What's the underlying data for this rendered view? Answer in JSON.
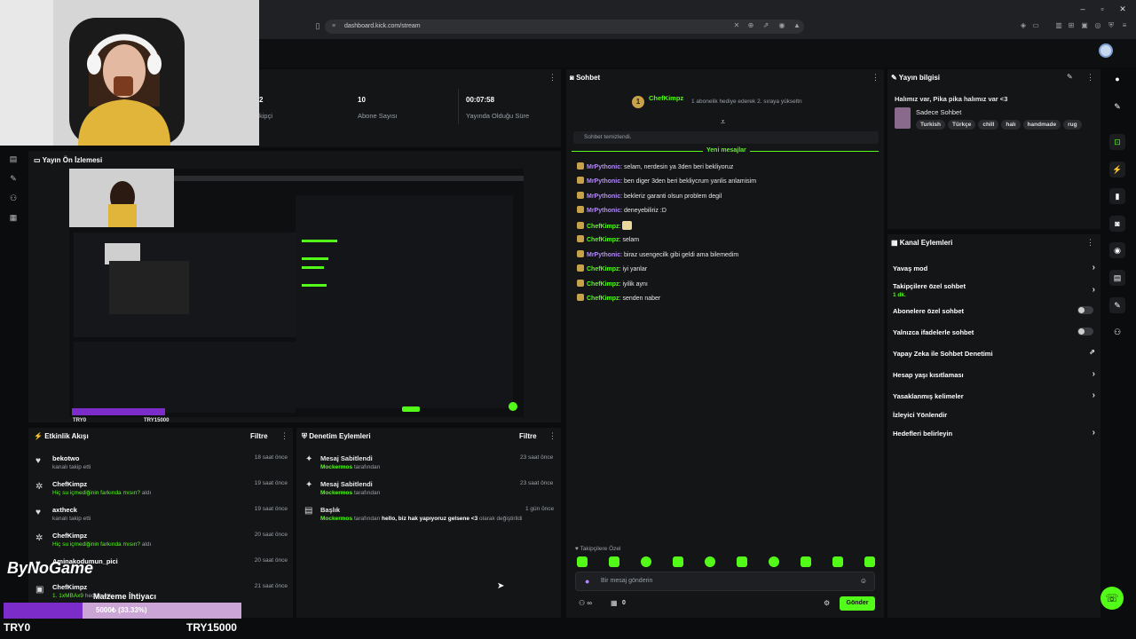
{
  "browser": {
    "url": "dashboard.kick.com/stream"
  },
  "stats": [
    {
      "value": "2",
      "label": "kipçi"
    },
    {
      "value": "10",
      "label": "Abone Sayısı"
    },
    {
      "value": "00:07:58",
      "label": "Yayında Olduğu Süre"
    }
  ],
  "preview": {
    "title": "Yayın Ön İzlemesi",
    "bar_left": "TRY0",
    "bar_right": "TRY15000"
  },
  "activity": {
    "title": "Etkinlik Akışı",
    "filter": "Filtre",
    "items": [
      {
        "user": "bekotwo",
        "sub": "kanalı takip etti",
        "time": "18 saat önce",
        "icon": "heart-icon"
      },
      {
        "user": "ChefKimpz",
        "sub_green": "Hiç su içmediğinin farkında mısın?",
        "sub": "aldı",
        "time": "19 saat önce",
        "icon": "reward-icon"
      },
      {
        "user": "axtheck",
        "sub": "kanalı takip etti",
        "time": "19 saat önce",
        "icon": "heart-icon"
      },
      {
        "user": "ChefKimpz",
        "sub_green": "Hiç su içmediğinin farkında mısın?",
        "sub": "aldı",
        "time": "20 saat önce",
        "icon": "reward-icon"
      },
      {
        "user": "Aminakodumun_pici",
        "sub": "",
        "time": "20 saat önce",
        "icon": "heart-icon"
      },
      {
        "user": "ChefKimpz",
        "sub_green": "1. 1xMBAx9",
        "sub": "hediye etti.",
        "time": "21 saat önce",
        "icon": "gift-icon"
      }
    ]
  },
  "moderation": {
    "title": "Denetim Eylemleri",
    "filter": "Filtre",
    "items": [
      {
        "title": "Mesaj Sabitlendi",
        "by": "Mockermos",
        "by_suffix": "tarafından",
        "time": "23 saat önce"
      },
      {
        "title": "Mesaj Sabitlendi",
        "by": "Mockermos",
        "by_suffix": "tarafından",
        "time": "23 saat önce"
      },
      {
        "title": "Başlık",
        "by": "Mockermos",
        "by_suffix": "tarafından",
        "text_bold": "hello, biz hak yapıyoruz gelsene <3",
        "text_end": "olarak değiştirildi",
        "time": "1 gün önce"
      }
    ]
  },
  "chat": {
    "title": "Sohbet",
    "pinned_user": "ChefKimpz",
    "pinned_text": "1 abonelik hediye ederek 2. sıraya yükseltn",
    "cleared": "Sohbet temizlendi.",
    "new_messages": "Yeni mesajlar",
    "messages": [
      {
        "user": "MrPythonic",
        "text": "selam, nerdesin ya 3den beri bekliyoruz"
      },
      {
        "user": "MrPythonic",
        "text": "ben diger 3den beri bekliycrum yanlis anlamisim"
      },
      {
        "user": "MrPythonic",
        "text": "bekleriz garanti olsun problem degil"
      },
      {
        "user": "MrPythonic",
        "text": "deneyebiliriz :D"
      },
      {
        "user": "ChefKimpz",
        "text": ""
      },
      {
        "user": "ChefKimpz",
        "text": "selam"
      },
      {
        "user": "MrPythonic",
        "text": "biraz usengecilk gibi geldi ama bilemedim"
      },
      {
        "user": "ChefKimpz",
        "text": "iyi yanlar"
      },
      {
        "user": "ChefKimpz",
        "text": "iyilik aynı"
      },
      {
        "user": "ChefKimpz",
        "text": "senden naber"
      }
    ],
    "followers_only": "Takipçilere Özel",
    "input_placeholder": "Bir mesaj gönderin",
    "viewers": "0",
    "send": "Gönder"
  },
  "stream_info": {
    "title": "Yayın bilgisi",
    "stream_title": "Halımız var, Pika pika halımız var <3",
    "category": "Sadece Sohbet",
    "tags": [
      "Turkish",
      "Türkçe",
      "chill",
      "halı",
      "handmade",
      "rug"
    ]
  },
  "channel_actions": {
    "title": "Kanal Eylemleri",
    "items": [
      {
        "label": "Yavaş mod",
        "control": "chevron"
      },
      {
        "label": "Takipçilere özel sohbet",
        "sub": "1 dk.",
        "control": "chevron"
      },
      {
        "label": "Abonelere özel sohbet",
        "control": "toggle"
      },
      {
        "label": "Yalnızca ifadelerle sohbet",
        "control": "toggle"
      },
      {
        "label": "Yapay Zeka ile Sohbet Denetimi",
        "control": "external"
      },
      {
        "label": "Hesap yaşı kısıtlaması",
        "control": "chevron"
      },
      {
        "label": "Yasaklanmış kelimeler",
        "control": "chevron"
      },
      {
        "label": "İzleyici Yönlendir",
        "control": "none"
      },
      {
        "label": "Hedefleri belirleyin",
        "control": "chevron"
      }
    ]
  },
  "overlay": {
    "logo": "ByNoGame",
    "goal_label": "Malzeme İhtiyacı",
    "goal_progress_text": "5000₺ (33.33%)",
    "goal_fraction": 0.3333,
    "goal_min": "TRY0",
    "goal_max": "TRY15000"
  },
  "colors": {
    "accent": "#53fc18",
    "goal_fill": "#7b2cc9"
  }
}
